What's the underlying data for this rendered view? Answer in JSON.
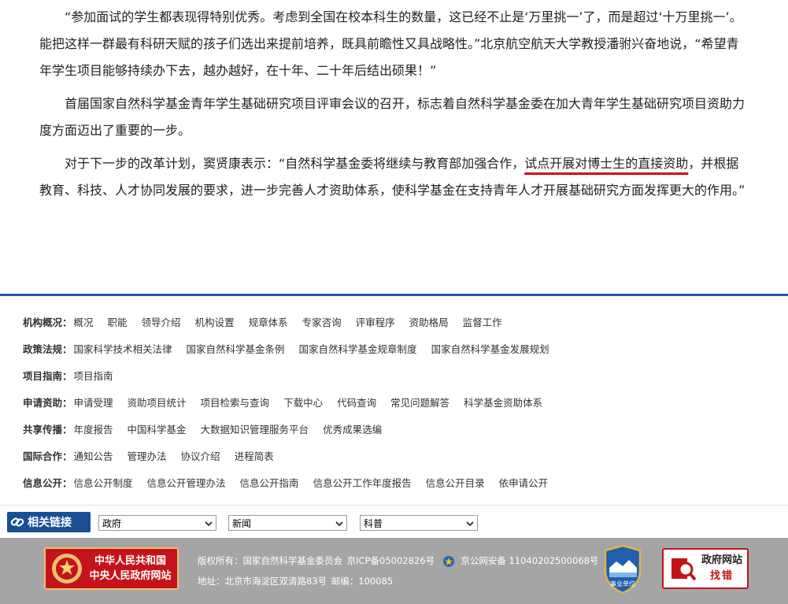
{
  "article": {
    "p1": "“参加面试的学生都表现得特别优秀。考虑到全国在校本科生的数量，这已经不止是‘万里挑一’了，而是超过‘十万里挑一’。能把这样一群最有科研天赋的孩子们选出来提前培养，既具前瞻性又具战略性。”北京航空航天大学教授潘驸兴奋地说，“希望青年学生项目能够持续办下去，越办越好，在十年、二十年后结出硕果！”",
    "p2": "首届国家自然科学基金青年学生基础研究项目评审会议的召开，标志着自然科学基金委在加大青年学生基础研究项目资助力度方面迈出了重要的一步。",
    "p3_before": "对于下一步的改革计划，窦贤康表示：“自然科学基金委将继续与教育部加强合作，",
    "p3_highlight": "试点开展对博士生的直接资助",
    "p3_after": "，并根据教育、科技、人才协同发展的要求，进一步完善人才资助体系，使科学基金在支持青年人才开展基础研究方面发挥更大的作用。”"
  },
  "footer_nav": [
    {
      "label": "机构概况：",
      "links": [
        "概况",
        "职能",
        "领导介绍",
        "机构设置",
        "规章体系",
        "专家咨询",
        "评审程序",
        "资助格局",
        "监督工作"
      ]
    },
    {
      "label": "政策法规：",
      "links": [
        "国家科学技术相关法律",
        "国家自然科学基金条例",
        "国家自然科学基金规章制度",
        "国家自然科学基金发展规划"
      ]
    },
    {
      "label": "项目指南：",
      "links": [
        "项目指南"
      ]
    },
    {
      "label": "申请资助：",
      "links": [
        "申请受理",
        "资助项目统计",
        "项目检索与查询",
        "下载中心",
        "代码查询",
        "常见问题解答",
        "科学基金资助体系"
      ]
    },
    {
      "label": "共享传播：",
      "links": [
        "年度报告",
        "中国科学基金",
        "大数据知识管理服务平台",
        "优秀成果选编"
      ]
    },
    {
      "label": "国际合作：",
      "links": [
        "通知公告",
        "管理办法",
        "协议介绍",
        "进程简表"
      ]
    },
    {
      "label": "信息公开：",
      "links": [
        "信息公开制度",
        "信息公开管理办法",
        "信息公开指南",
        "信息公开工作年度报告",
        "信息公开目录",
        "依申请公开"
      ]
    }
  ],
  "links_bar": {
    "title": "相关链接",
    "selects": [
      "政府",
      "新闻",
      "科普"
    ]
  },
  "bottom": {
    "gov_line1": "中华人民共和国",
    "gov_line2": "中央人民政府网站",
    "copyright": "版权所有：国家自然科学基金委员会",
    "icp": "京ICP备05002826号",
    "police": "京公网安备 11040202500068号",
    "address": "地址：北京市海淀区双清路83号",
    "zip": "邮编：100085",
    "shield_label": "事业单位",
    "err_line1": "政府网站",
    "err_line2": "找错"
  },
  "colors": {
    "accent": "#1e5aa8",
    "badge": "#1b4f95",
    "gov_red": "#c5131b",
    "footer_gray": "#a5a5a5",
    "underline": "#d9001b"
  }
}
